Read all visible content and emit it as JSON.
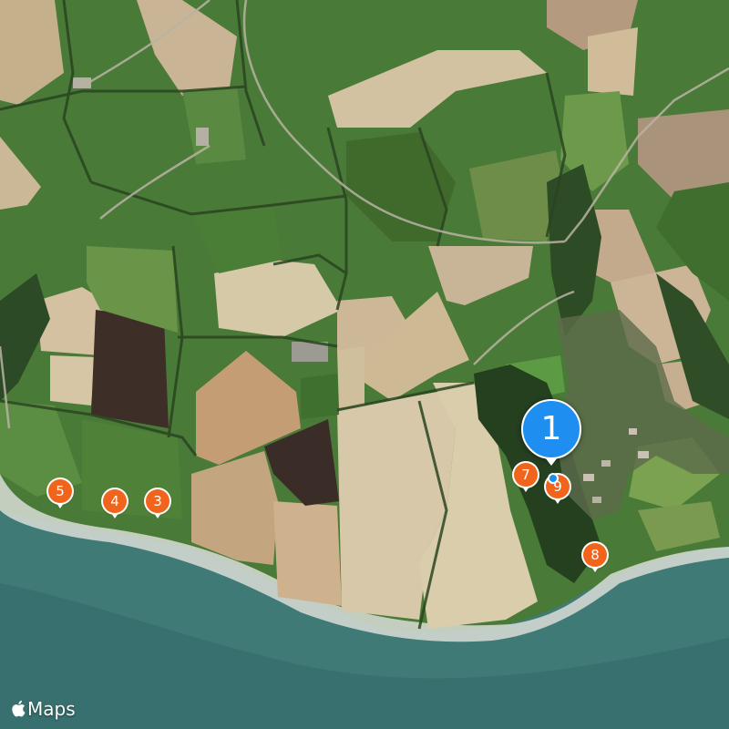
{
  "attribution": {
    "apple_glyph": "apple-logo-icon",
    "text": "Maps"
  },
  "selected_marker": {
    "label": "1",
    "color": "#1e8ef0"
  },
  "markers": [
    {
      "id": "3",
      "label": "3",
      "color": "#f0641c"
    },
    {
      "id": "4",
      "label": "4",
      "color": "#f0641c"
    },
    {
      "id": "5",
      "label": "5",
      "color": "#f0641c"
    },
    {
      "id": "7",
      "label": "7",
      "color": "#f0641c"
    },
    {
      "id": "8",
      "label": "8",
      "color": "#f0641c"
    },
    {
      "id": "9",
      "label": "9",
      "color": "#f0641c"
    }
  ],
  "colors": {
    "sea": "#3f7a76",
    "sea_deep": "#356c6b",
    "surf": "#d9ddd6",
    "pasture": "#4f7d3b",
    "pasture_dark": "#365f2a",
    "field_tan": "#c9b595",
    "field_brown": "#3e2f28",
    "woodland": "#24401f",
    "road": "#b9b3a3"
  }
}
